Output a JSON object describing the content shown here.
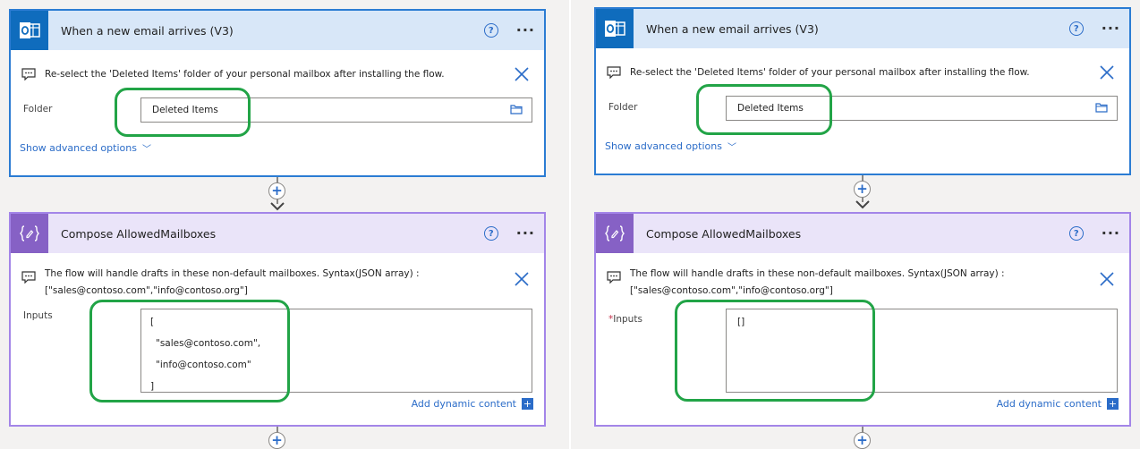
{
  "trigger": {
    "title": "When a new email arrives (V3)",
    "help": "?",
    "more": "···",
    "note": "Re-select the 'Deleted Items' folder of your personal mailbox after installing the flow.",
    "folder_label": "Folder",
    "folder_value": "Deleted Items",
    "advanced_link": "Show advanced options",
    "chevron": "﹀"
  },
  "compose": {
    "title": "Compose AllowedMailboxes",
    "help": "?",
    "more": "···",
    "note_line1": "The flow will handle drafts in these non-default mailboxes. Syntax(JSON array) :",
    "note_line2": "[\"sales@contoso.com\",\"info@contoso.org\"]",
    "inputs_label": "Inputs",
    "required_star": "*",
    "left_input_lines": [
      "[",
      "\"sales@contoso.com\",",
      "\"info@contoso.com\"",
      "]"
    ],
    "right_input_value": "[]",
    "dynamic_link": "Add dynamic content",
    "dynamic_plus": "+"
  },
  "connector_plus": "+",
  "colors": {
    "trigger_border": "#2b7cd3",
    "trigger_header": "#d8e7f8",
    "compose_border": "#a385e8",
    "compose_header": "#eae4f9",
    "link": "#2b6cc8",
    "highlight": "#22a447"
  }
}
